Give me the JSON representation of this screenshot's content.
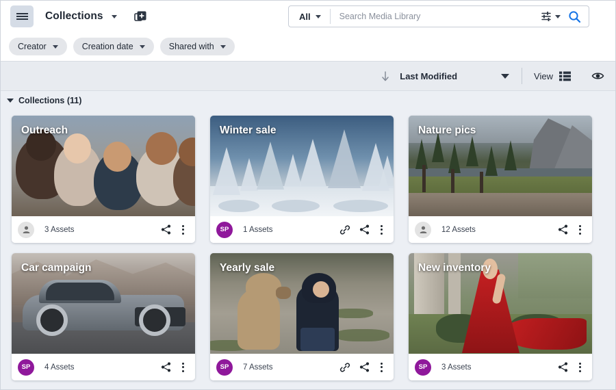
{
  "header": {
    "menu_icon": "hamburger-icon",
    "title": "Collections",
    "title_caret_icon": "chevron-down-icon",
    "new_collection_icon": "add-collection-icon"
  },
  "search": {
    "scope_label": "All",
    "scope_caret_icon": "chevron-down-icon",
    "placeholder": "Search Media Library",
    "value": "",
    "filter_icon": "search-settings-icon",
    "filter_caret_icon": "chevron-down-icon",
    "submit_icon": "search-icon",
    "accent_color": "#1473e6"
  },
  "filters": [
    {
      "label": "Creator",
      "caret_icon": "chevron-down-icon"
    },
    {
      "label": "Creation date",
      "caret_icon": "chevron-down-icon"
    },
    {
      "label": "Shared with",
      "caret_icon": "chevron-down-icon"
    }
  ],
  "sortbar": {
    "direction_icon": "arrow-down-icon",
    "sort_label": "Last Modified",
    "sort_caret_icon": "chevron-down-icon",
    "view_label": "View",
    "view_icon": "list-view-icon",
    "preview_icon": "eye-icon"
  },
  "section": {
    "caret_icon": "chevron-down-icon",
    "title": "Collections (11)",
    "count": 11
  },
  "cards": [
    {
      "title": "Outreach",
      "thumb_class": "th-outreach",
      "avatar": {
        "type": "gray",
        "initials": "",
        "icon": "person-icon"
      },
      "assets": "3 Assets",
      "has_link": false,
      "share_icon": "share-icon",
      "menu_icon": "more-options-icon"
    },
    {
      "title": "Winter sale",
      "thumb_class": "th-winter",
      "avatar": {
        "type": "purple",
        "initials": "SP",
        "icon": ""
      },
      "assets": "1 Assets",
      "has_link": true,
      "link_icon": "link-icon",
      "share_icon": "share-icon",
      "menu_icon": "more-options-icon"
    },
    {
      "title": "Nature pics",
      "thumb_class": "th-nature",
      "avatar": {
        "type": "gray",
        "initials": "",
        "icon": "person-icon"
      },
      "assets": "12 Assets",
      "has_link": false,
      "share_icon": "share-icon",
      "menu_icon": "more-options-icon"
    },
    {
      "title": "Car campaign",
      "thumb_class": "th-car",
      "avatar": {
        "type": "purple",
        "initials": "SP",
        "icon": ""
      },
      "assets": "4 Assets",
      "has_link": false,
      "share_icon": "share-icon",
      "menu_icon": "more-options-icon"
    },
    {
      "title": "Yearly sale",
      "thumb_class": "th-yearly",
      "avatar": {
        "type": "purple",
        "initials": "SP",
        "icon": ""
      },
      "assets": "7 Assets",
      "has_link": true,
      "link_icon": "link-icon",
      "share_icon": "share-icon",
      "menu_icon": "more-options-icon"
    },
    {
      "title": "New inventory",
      "thumb_class": "th-newinv",
      "avatar": {
        "type": "purple",
        "initials": "SP",
        "icon": ""
      },
      "assets": "3 Assets",
      "has_link": false,
      "share_icon": "share-icon",
      "menu_icon": "more-options-icon"
    }
  ],
  "colors": {
    "avatar_purple": "#8f189b",
    "search_accent": "#1473e6",
    "chip_bg": "#e4e6ea",
    "sortbar_bg": "#e8ebf0",
    "page_bg": "#eceff4"
  }
}
